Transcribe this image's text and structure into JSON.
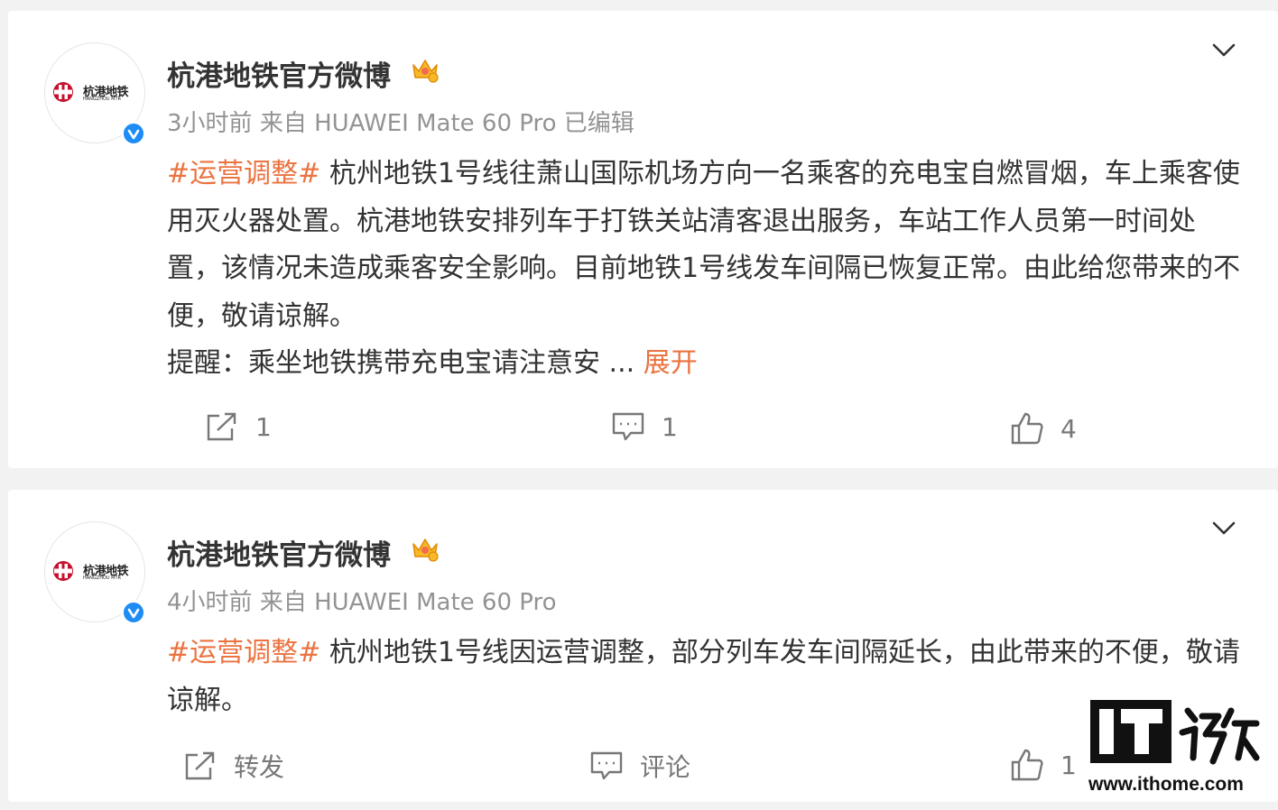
{
  "posts": [
    {
      "author": "杭港地铁官方微博",
      "logo_text": "杭港地铁",
      "logo_subtext": "HANGZHOU MTR",
      "time": "3小时前",
      "source": "来自 HUAWEI Mate 60 Pro",
      "edited": "已编辑",
      "tag": "#运营调整#",
      "text": " 杭州地铁1号线往萧山国际机场方向一名乘客的充电宝自燃冒烟，车上乘客使用灭火器处置。杭港地铁安排列车于打铁关站清客退出服务，车站工作人员第一时间处置，该情况未造成乘客安全影响。目前地铁1号线发车间隔已恢复正常。由此给您带来的不便，敬请谅解。",
      "reminder": "提醒：乘坐地铁携带充电宝请注意安 ...",
      "expand_label": "展开",
      "repost_count": "1",
      "comment_count": "1",
      "like_count": "4"
    },
    {
      "author": "杭港地铁官方微博",
      "logo_text": "杭港地铁",
      "logo_subtext": "HANGZHOU MTR",
      "time": "4小时前",
      "source": "来自 HUAWEI Mate 60 Pro",
      "tag": "#运营调整#",
      "text": " 杭州地铁1号线因运营调整，部分列车发车间隔延长，由此带来的不便，敬请谅解。",
      "repost_label": "转发",
      "comment_label": "评论",
      "like_count": "1"
    }
  ],
  "watermark": {
    "logo": "IT之家",
    "url": "www.ithome.com"
  },
  "colors": {
    "tag": "#eb7340",
    "verified": "#1d8cf5",
    "meta": "#939393",
    "background": "#f2f2f2"
  },
  "icons": [
    "chevron-down-icon",
    "verified-icon",
    "crown-icon",
    "repost-icon",
    "comment-icon",
    "like-icon"
  ]
}
